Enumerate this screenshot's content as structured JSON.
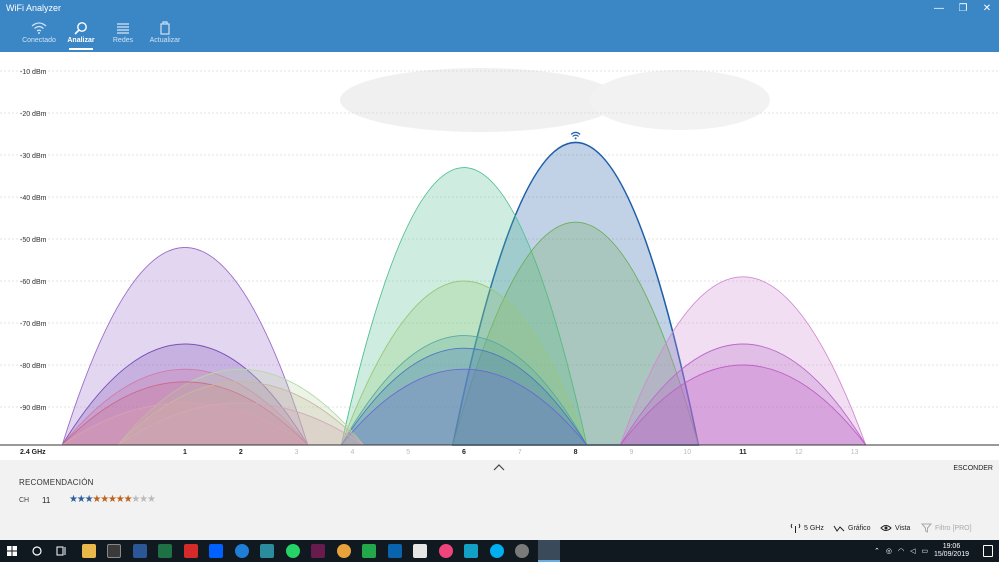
{
  "app": {
    "title": "WiFi Analyzer",
    "window_buttons": {
      "minimize": "—",
      "restore": "❐",
      "close": "✕"
    }
  },
  "nav": {
    "items": [
      {
        "label": "Conectado",
        "icon": "wifi-icon"
      },
      {
        "label": "Analizar",
        "icon": "magnifier-icon",
        "active": true
      },
      {
        "label": "Redes",
        "icon": "list-icon"
      },
      {
        "label": "Actualizar",
        "icon": "refresh-icon"
      }
    ]
  },
  "chart_data": {
    "type": "area",
    "band_label": "2.4 GHz",
    "y_ticks": [
      "-10 dBm",
      "-20 dBm",
      "-30 dBm",
      "-40 dBm",
      "-50 dBm",
      "-60 dBm",
      "-70 dBm",
      "-80 dBm",
      "-90 dBm"
    ],
    "ylim": [
      -100,
      -10
    ],
    "x_ticks": [
      {
        "ch": "1",
        "bold": true
      },
      {
        "ch": "2",
        "bold": true
      },
      {
        "ch": "3",
        "bold": false
      },
      {
        "ch": "4",
        "bold": false
      },
      {
        "ch": "5",
        "bold": false
      },
      {
        "ch": "6",
        "bold": true
      },
      {
        "ch": "7",
        "bold": false
      },
      {
        "ch": "8",
        "bold": true
      },
      {
        "ch": "9",
        "bold": false
      },
      {
        "ch": "10",
        "bold": false
      },
      {
        "ch": "11",
        "bold": true
      },
      {
        "ch": "12",
        "bold": false
      },
      {
        "ch": "13",
        "bold": false
      }
    ],
    "connected_channel": 8,
    "networks": [
      {
        "channel": 1,
        "dbm": -52,
        "color": "#9b6bc8"
      },
      {
        "channel": 1,
        "dbm": -75,
        "color": "#7b52b8"
      },
      {
        "channel": 1,
        "dbm": -81,
        "color": "#d07aa8"
      },
      {
        "channel": 1,
        "dbm": -84,
        "color": "#c86a8a"
      },
      {
        "channel": 1,
        "dbm": -89,
        "color": "#d9a0b0"
      },
      {
        "channel": 2,
        "dbm": -81,
        "color": "#b8d8a8"
      },
      {
        "channel": 2,
        "dbm": -84,
        "color": "#c8b8a0"
      },
      {
        "channel": 2,
        "dbm": -89,
        "color": "#d0a8b8"
      },
      {
        "channel": 6,
        "dbm": -33,
        "color": "#4fbf8f"
      },
      {
        "channel": 6,
        "dbm": -60,
        "color": "#98c878"
      },
      {
        "channel": 6,
        "dbm": -73,
        "color": "#5aa8a0"
      },
      {
        "channel": 6,
        "dbm": -76,
        "color": "#4a78c0"
      },
      {
        "channel": 6,
        "dbm": -81,
        "color": "#6a6ad0"
      },
      {
        "channel": 8,
        "dbm": -27,
        "color": "#1f5fa8",
        "connected": true
      },
      {
        "channel": 8,
        "dbm": -46,
        "color": "#6aae5a"
      },
      {
        "channel": 11,
        "dbm": -59,
        "color": "#d08ad0"
      },
      {
        "channel": 11,
        "dbm": -75,
        "color": "#b86ac8"
      },
      {
        "channel": 11,
        "dbm": -80,
        "color": "#c060c8"
      }
    ]
  },
  "collapse": {
    "hide_label": "ESCONDER"
  },
  "recommendation": {
    "title": "RECOMENDACIÓN",
    "ch_label": "CH",
    "channel": "11",
    "rating": 8,
    "max_rating": 11
  },
  "bottom_bar": {
    "band_button": "5 GHz",
    "chart_button": "Gráfico",
    "view_button": "Vista",
    "filter_button": "Filtro [PRO]"
  },
  "taskbar": {
    "time": "19:06",
    "date": "15/09/2019"
  }
}
